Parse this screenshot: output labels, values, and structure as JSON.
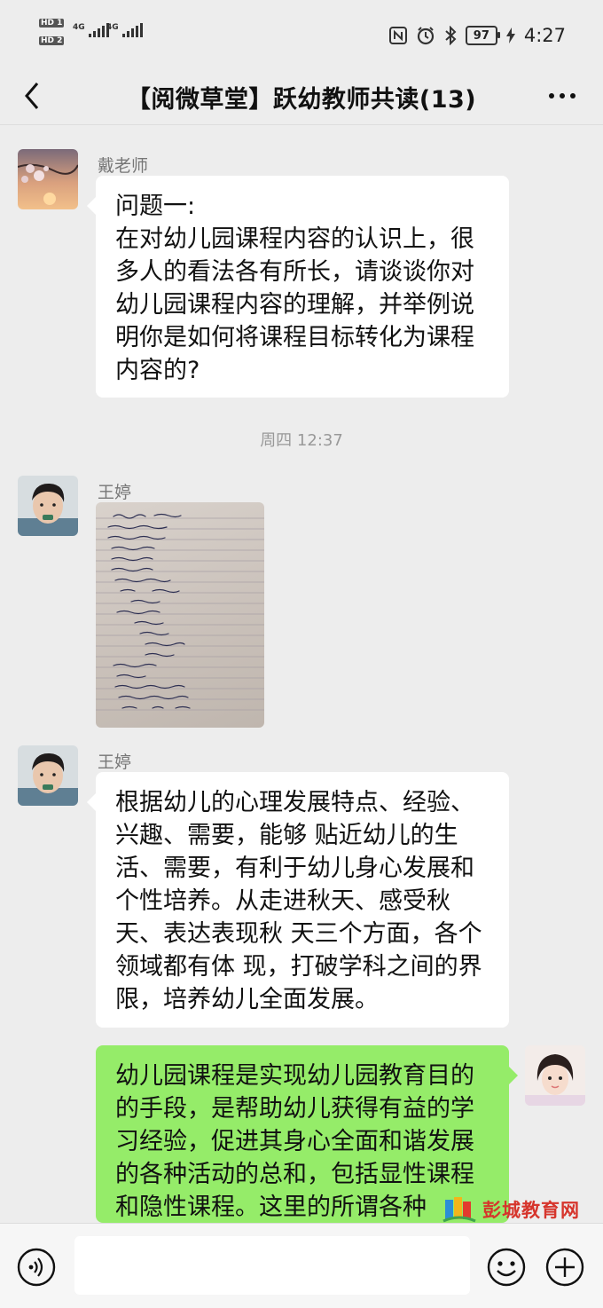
{
  "status_bar": {
    "hd1": "HD 1",
    "hd2": "HD 2",
    "net1": "4G",
    "net2": "4G",
    "icons": [
      "nfc-icon",
      "alarm-icon",
      "bluetooth-icon"
    ],
    "battery": "97",
    "time": "4:27"
  },
  "header": {
    "title": "【阅微草堂】跃幼教师共读(13)"
  },
  "messages": [
    {
      "sender": "戴老师",
      "text": "问题一:\n在对幼儿园课程内容的认识上，很多人的看法各有所长，请谈谈你对幼儿园课程内容的理解，并举例说明你是如何将课程目标转化为课程内容的?"
    },
    {
      "sender": "王婷",
      "type": "image",
      "image_desc": "handwritten-notes-photo"
    },
    {
      "sender": "王婷",
      "text": "根据幼儿的心理发展特点、经验、兴趣、需要，能够 贴近幼儿的生活、需要，有利于幼儿身心发展和个性培养。从走进秋天、感受秋天、表达表现秋 天三个方面，各个领域都有体 现，打破学科之间的界限，培养幼儿全面发展。"
    },
    {
      "sender": "self",
      "text": "幼儿园课程是实现幼儿园教育目的的手段，是帮助幼儿获得有益的学习经验，促进其身心全面和谐发展的各种活动的总和，包括显性课程和隐性课程。这里的所谓各种"
    }
  ],
  "timestamp": "周四 12:37",
  "watermark": {
    "text": "彭城教育网"
  },
  "input_bar": {
    "value": "",
    "placeholder": ""
  },
  "colors": {
    "background": "#ededed",
    "self_bubble": "#95ec69",
    "other_bubble": "#ffffff",
    "watermark": "#d6352c"
  }
}
